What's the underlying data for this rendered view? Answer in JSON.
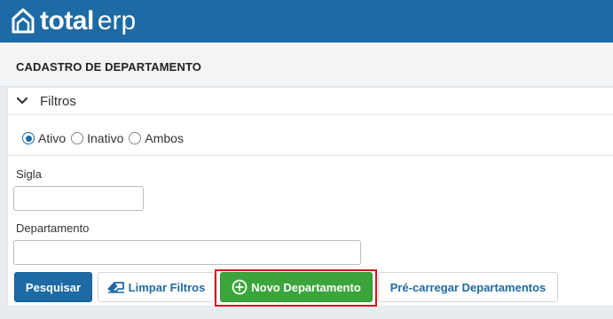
{
  "brand": {
    "name_bold": "total",
    "name_light": "erp"
  },
  "page": {
    "title": "CADASTRO DE DEPARTAMENTO"
  },
  "filters": {
    "title": "Filtros",
    "status_options": [
      {
        "label": "Ativo",
        "checked": true
      },
      {
        "label": "Inativo",
        "checked": false
      },
      {
        "label": "Ambos",
        "checked": false
      }
    ],
    "sigla": {
      "label": "Sigla",
      "value": "",
      "placeholder": ""
    },
    "departamento": {
      "label": "Departamento",
      "value": "",
      "placeholder": ""
    }
  },
  "actions": {
    "search": "Pesquisar",
    "clear": "Limpar Filtros",
    "new": "Novo Departamento",
    "preload": "Pré-carregar Departamentos"
  },
  "colors": {
    "brand_blue": "#1d6aa4",
    "success_green": "#3ba53b",
    "highlight_red": "#d6101b"
  },
  "icons": [
    "house-logo-icon",
    "chevron-down-icon",
    "eraser-icon",
    "plus-circle-icon"
  ]
}
